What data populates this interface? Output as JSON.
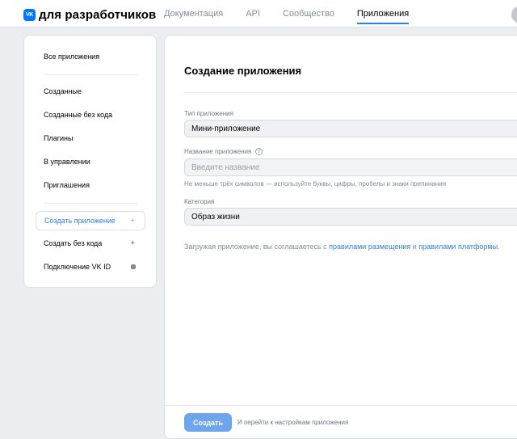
{
  "header": {
    "logo_mark": "VK",
    "logo_text": "для разработчиков",
    "nav": [
      "Документация",
      "API",
      "Сообщество",
      "Приложения"
    ],
    "active_nav": "Приложения"
  },
  "sidebar": {
    "items": [
      "Все приложения",
      "Созданные",
      "Созданные без кода",
      "Плагины",
      "В управлении",
      "Приглашения",
      "Создать приложение",
      "Создать без кода",
      "Подключение VK ID"
    ],
    "active_item": "Создать приложение",
    "icons": {
      "create": "+",
      "create_nocode": "✦",
      "vkid": "■"
    }
  },
  "form": {
    "title": "Создание приложения",
    "type_label": "Тип приложения",
    "type_value": "Мини-приложение",
    "name_label": "Название приложения",
    "name_placeholder": "Введите название",
    "name_hint": "Не меньше трёх символов — используйте буквы, цифры, пробелы и знаки препинания",
    "category_label": "Категория",
    "category_value": "Образ жизни",
    "agree_prefix": "Загружая приложение, вы соглашаетесь с ",
    "agree_link1": "правилами размещения",
    "agree_mid": " и ",
    "agree_link2": "правилами платформы",
    "agree_suffix": "."
  },
  "footer": {
    "create_button": "Создать",
    "note": "И перейти к настройкам приложения"
  },
  "colors": {
    "accent": "#2d81e0",
    "button": "#6ea6ee",
    "background": "#ebedf0"
  }
}
